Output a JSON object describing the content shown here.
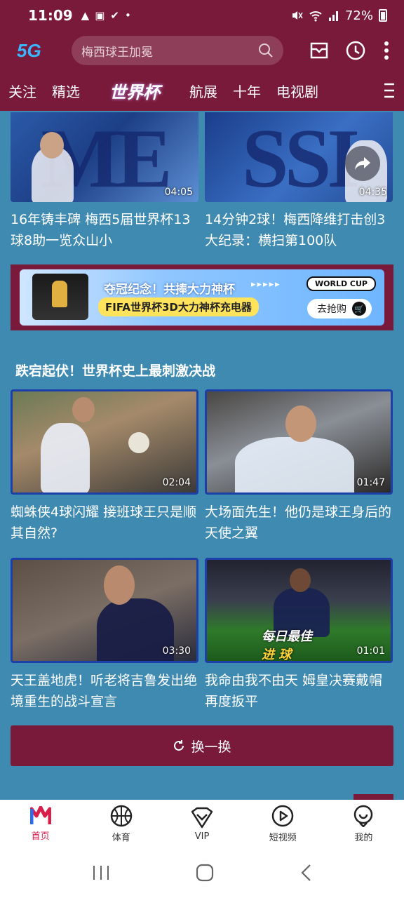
{
  "status_bar": {
    "time": "11:09",
    "battery_percent": "72%",
    "battery_level": 0.72,
    "icons_left": [
      "warning-icon",
      "image-icon",
      "check-icon",
      "dot-icon"
    ],
    "icons_right": [
      "mute-icon",
      "wifi-icon",
      "signal-icon",
      "battery-icon"
    ]
  },
  "header": {
    "logo": "5G",
    "search_placeholder": "梅西球王加冕",
    "icons": [
      "mail-icon",
      "clock-icon",
      "more-icon"
    ]
  },
  "tabs": {
    "items": [
      {
        "label": "关注"
      },
      {
        "label": "精选"
      },
      {
        "label": "世界杯",
        "active": true
      },
      {
        "label": "航展"
      },
      {
        "label": "十年"
      },
      {
        "label": "电视剧"
      }
    ]
  },
  "top_videos": [
    {
      "duration": "04:05",
      "title": "16年铸丰碑 梅西5届世界杯13球8助一览众山小",
      "letters": "ME"
    },
    {
      "duration": "04:35",
      "title": "14分钟2球！梅西降维打击创3大纪录：横扫第100队",
      "letters": "SSI"
    }
  ],
  "banner": {
    "line1": "夺冠纪念！共捧大力神杯",
    "arrows": "▸▸▸▸▸",
    "badge": "WORLD CUP",
    "line2": "FIFA世界杯3D大力神杯充电器",
    "button": "去抢购"
  },
  "section": {
    "title": "跌宕起伏！世界杯史上最刺激决战",
    "videos": [
      {
        "duration": "02:04",
        "title": "蜘蛛侠4球闪耀 接班球王只是顺其自然?"
      },
      {
        "duration": "01:47",
        "title": "大场面先生！他仍是球王身后的天使之翼"
      },
      {
        "duration": "03:30",
        "title": "天王盖地虎！听老将吉鲁发出绝境重生的战斗宣言"
      },
      {
        "duration": "01:01",
        "title": "我命由我不由天 姆皇决赛戴帽再度扳平",
        "badge_line1": "每日最佳",
        "badge_line2": "进 球"
      }
    ]
  },
  "refresh_label": "换一换",
  "bottom_nav": [
    {
      "label": "首页",
      "icon": "home-icon",
      "active": true
    },
    {
      "label": "体育",
      "icon": "basketball-icon"
    },
    {
      "label": "VIP",
      "icon": "vip-icon"
    },
    {
      "label": "短视频",
      "icon": "short-video-icon"
    },
    {
      "label": "我的",
      "icon": "profile-icon"
    }
  ],
  "colors": {
    "brand": "#7a1a3a",
    "background": "#3f8ab0",
    "active_nav": "#d81e4a"
  }
}
